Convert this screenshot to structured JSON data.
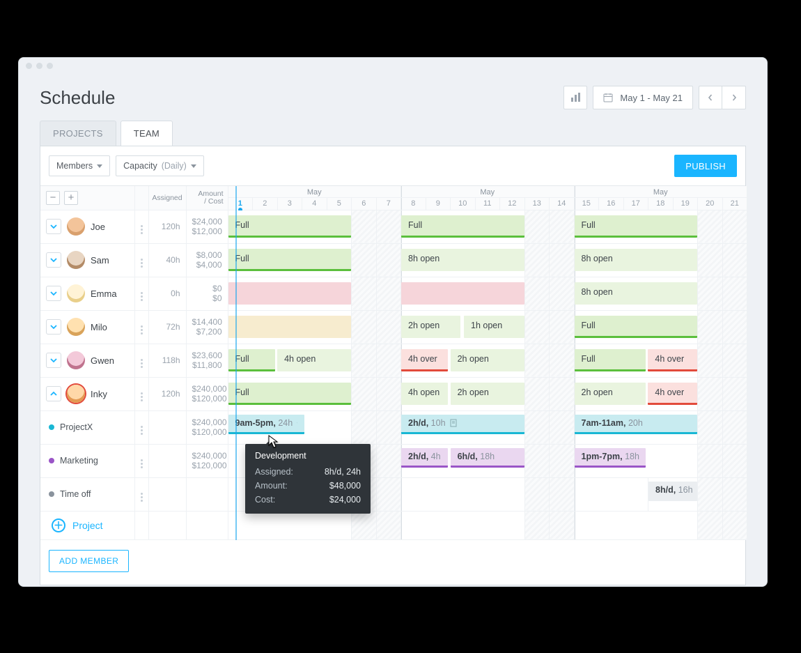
{
  "title": "Schedule",
  "date_range": "May 1 - May 21",
  "tabs": {
    "projects": "PROJECTS",
    "team": "TEAM"
  },
  "dropdowns": {
    "members": "Members",
    "capacity": "Capacity",
    "capacity_mode": "(Daily)"
  },
  "publish": "PUBLISH",
  "columns": {
    "assigned": "Assigned",
    "amount": "Amount",
    "cost": "/ Cost"
  },
  "weeks": {
    "label": "May",
    "days_w1": [
      "1",
      "2",
      "3",
      "4",
      "5",
      "6",
      "7"
    ],
    "days_w2": [
      "8",
      "9",
      "10",
      "11",
      "12",
      "13",
      "14"
    ],
    "days_w3": [
      "15",
      "16",
      "17",
      "18",
      "19",
      "20",
      "21"
    ]
  },
  "members": {
    "joe": {
      "name": "Joe",
      "assigned": "120h",
      "amount": "$24,000",
      "cost": "$12,000",
      "w1": "Full",
      "w2": "Full",
      "w3": "Full"
    },
    "sam": {
      "name": "Sam",
      "assigned": "40h",
      "amount": "$8,000",
      "cost": "$4,000",
      "w1": "Full",
      "w2": "8h open",
      "w3": "8h open"
    },
    "emma": {
      "name": "Emma",
      "assigned": "0h",
      "amount": "$0",
      "cost": "$0",
      "w3": "8h open"
    },
    "milo": {
      "name": "Milo",
      "assigned": "72h",
      "amount": "$14,400",
      "cost": "$7,200",
      "w2a": "2h open",
      "w2b": "1h open",
      "w3": "Full"
    },
    "gwen": {
      "name": "Gwen",
      "assigned": "118h",
      "amount": "$23,600",
      "cost": "$11,800",
      "w1a": "Full",
      "w1b": "4h open",
      "w2a": "4h over",
      "w2b": "2h open",
      "w3a": "Full",
      "w3b": "4h over"
    },
    "inky": {
      "name": "Inky",
      "assigned": "120h",
      "amount": "$240,000",
      "cost": "$120,000",
      "w1": "Full",
      "w2a": "4h open",
      "w2b": "2h open",
      "w3a": "2h open",
      "w3b": "4h over"
    }
  },
  "projects": {
    "projectx": {
      "name": "ProjectX",
      "amount": "$240,000",
      "cost": "$120,000",
      "w1_a": "9am-5pm,",
      "w1_b": "24h",
      "w2_a": "2h/d,",
      "w2_b": "10h",
      "w3_a": "7am-11am,",
      "w3_b": "20h"
    },
    "marketing": {
      "name": "Marketing",
      "amount": "$240,000",
      "cost": "$120,000",
      "w2a_a": "2h/d,",
      "w2a_b": "4h",
      "w2b_a": "6h/d,",
      "w2b_b": "18h",
      "w3_a": "1pm-7pm,",
      "w3_b": "18h"
    },
    "timeoff": {
      "name": "Time off",
      "w3_a": "8h/d,",
      "w3_b": "16h"
    }
  },
  "tooltip": {
    "title": "Development",
    "assigned_k": "Assigned:",
    "assigned_v": "8h/d, 24h",
    "amount_k": "Amount:",
    "amount_v": "$48,000",
    "cost_k": "Cost:",
    "cost_v": "$24,000"
  },
  "add_project": "Project",
  "add_member": "ADD MEMBER",
  "icons": {
    "barchart": "bar-chart-icon",
    "calendar": "calendar-icon",
    "prev": "chevron-left-icon",
    "next": "chevron-right-icon",
    "note": "note-icon",
    "more": "more-vertical-icon"
  },
  "avatar_colors": {
    "joe": {
      "bg": "#f3c49a",
      "fg": "#7a4b2b"
    },
    "sam": {
      "bg": "#e8d5c2",
      "fg": "#5b3a22"
    },
    "emma": {
      "bg": "#fff3d6",
      "fg": "#caa14d"
    },
    "milo": {
      "bg": "#ffe1b0",
      "fg": "#b07028"
    },
    "gwen": {
      "bg": "#f3c9d9",
      "fg": "#8b4a66"
    },
    "inky": {
      "bg": "#ffd8a8",
      "fg": "#c86b2e",
      "ring": "#e24a3b"
    }
  }
}
